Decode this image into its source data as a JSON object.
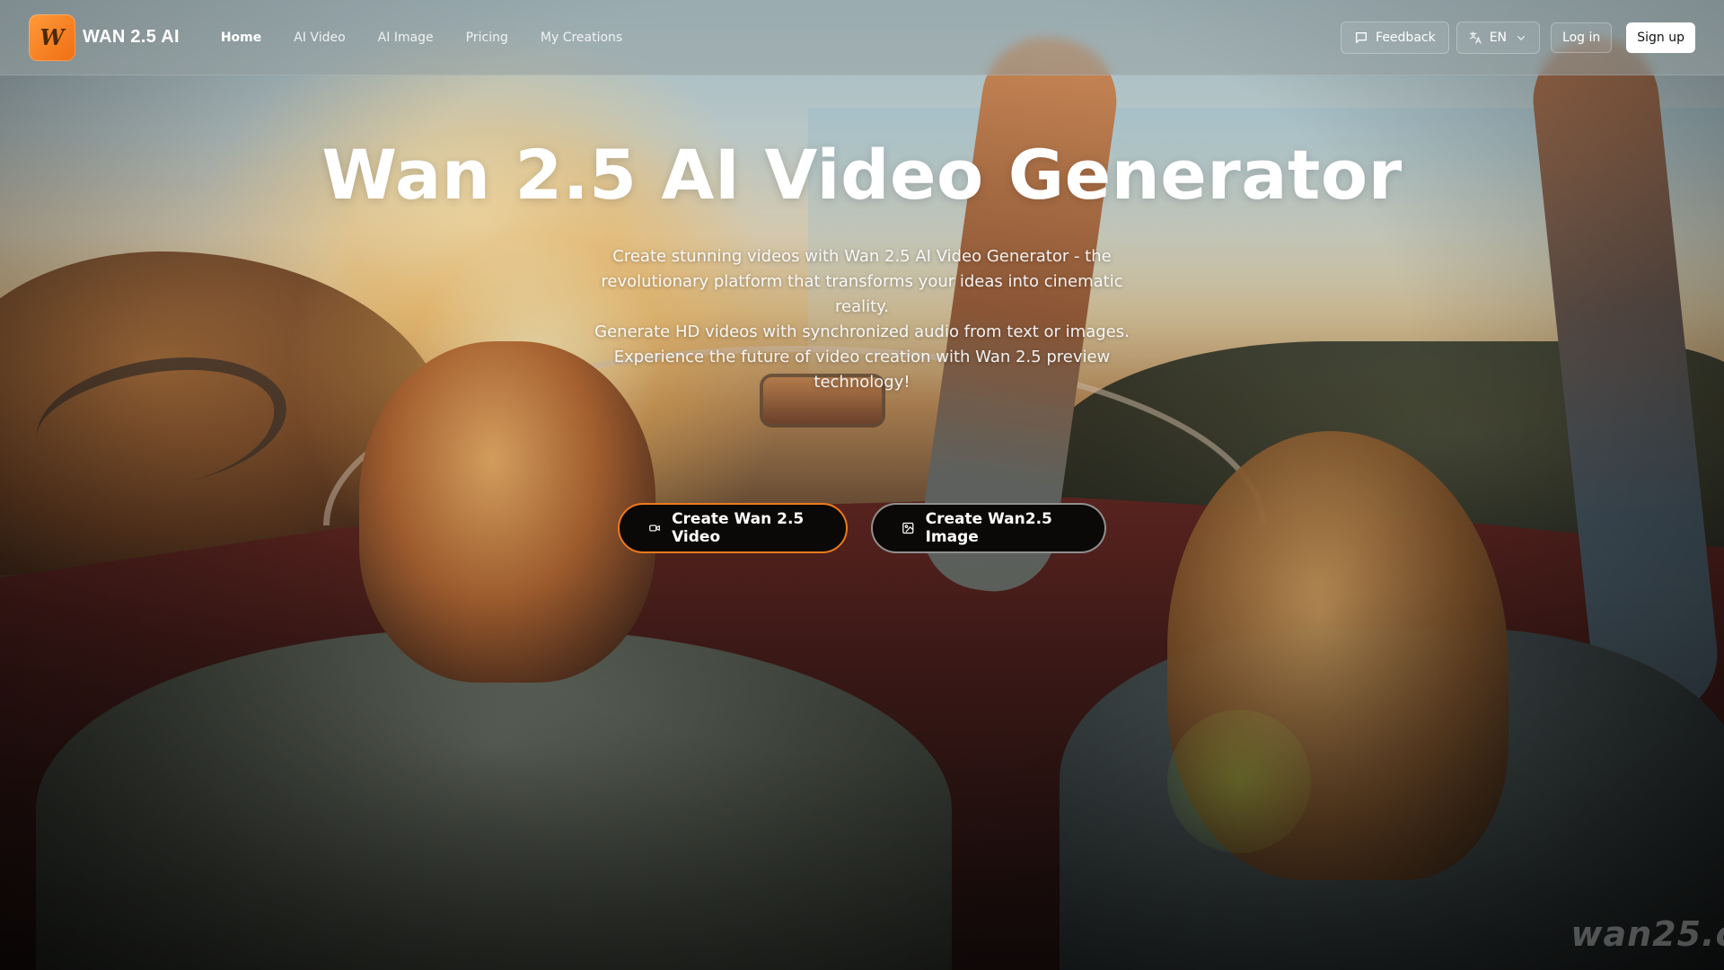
{
  "header": {
    "brand": "WAN 2.5 AI",
    "logo_letter": "W",
    "nav": [
      {
        "label": "Home",
        "active": true
      },
      {
        "label": "AI Video",
        "active": false
      },
      {
        "label": "AI Image",
        "active": false
      },
      {
        "label": "Pricing",
        "active": false
      },
      {
        "label": "My Creations",
        "active": false
      }
    ],
    "feedback_label": "Feedback",
    "language": "EN",
    "login_label": "Log in",
    "signup_label": "Sign up"
  },
  "hero": {
    "title": "Wan 2.5 AI Video Generator",
    "description_lines": [
      "Create stunning videos with Wan 2.5 AI Video Generator - the",
      "revolutionary platform that transforms your ideas into cinematic reality.",
      "Generate HD videos with synchronized audio from text or images.",
      "Experience the future of video creation with Wan 2.5 preview technology!"
    ],
    "cta_video": "Create Wan 2.5 Video",
    "cta_image": "Create Wan2.5 Image"
  },
  "watermark": "wan25.c",
  "colors": {
    "accent": "#f07a1a",
    "logo_bg": "#f47c1a",
    "cta_bg": "#0b0908",
    "signup_bg": "#ffffff"
  },
  "icons": {
    "feedback": "message-square-icon",
    "language": "translate-icon",
    "language_dropdown": "chevron-down-icon",
    "cta_video": "video-camera-icon",
    "cta_image": "image-icon"
  }
}
